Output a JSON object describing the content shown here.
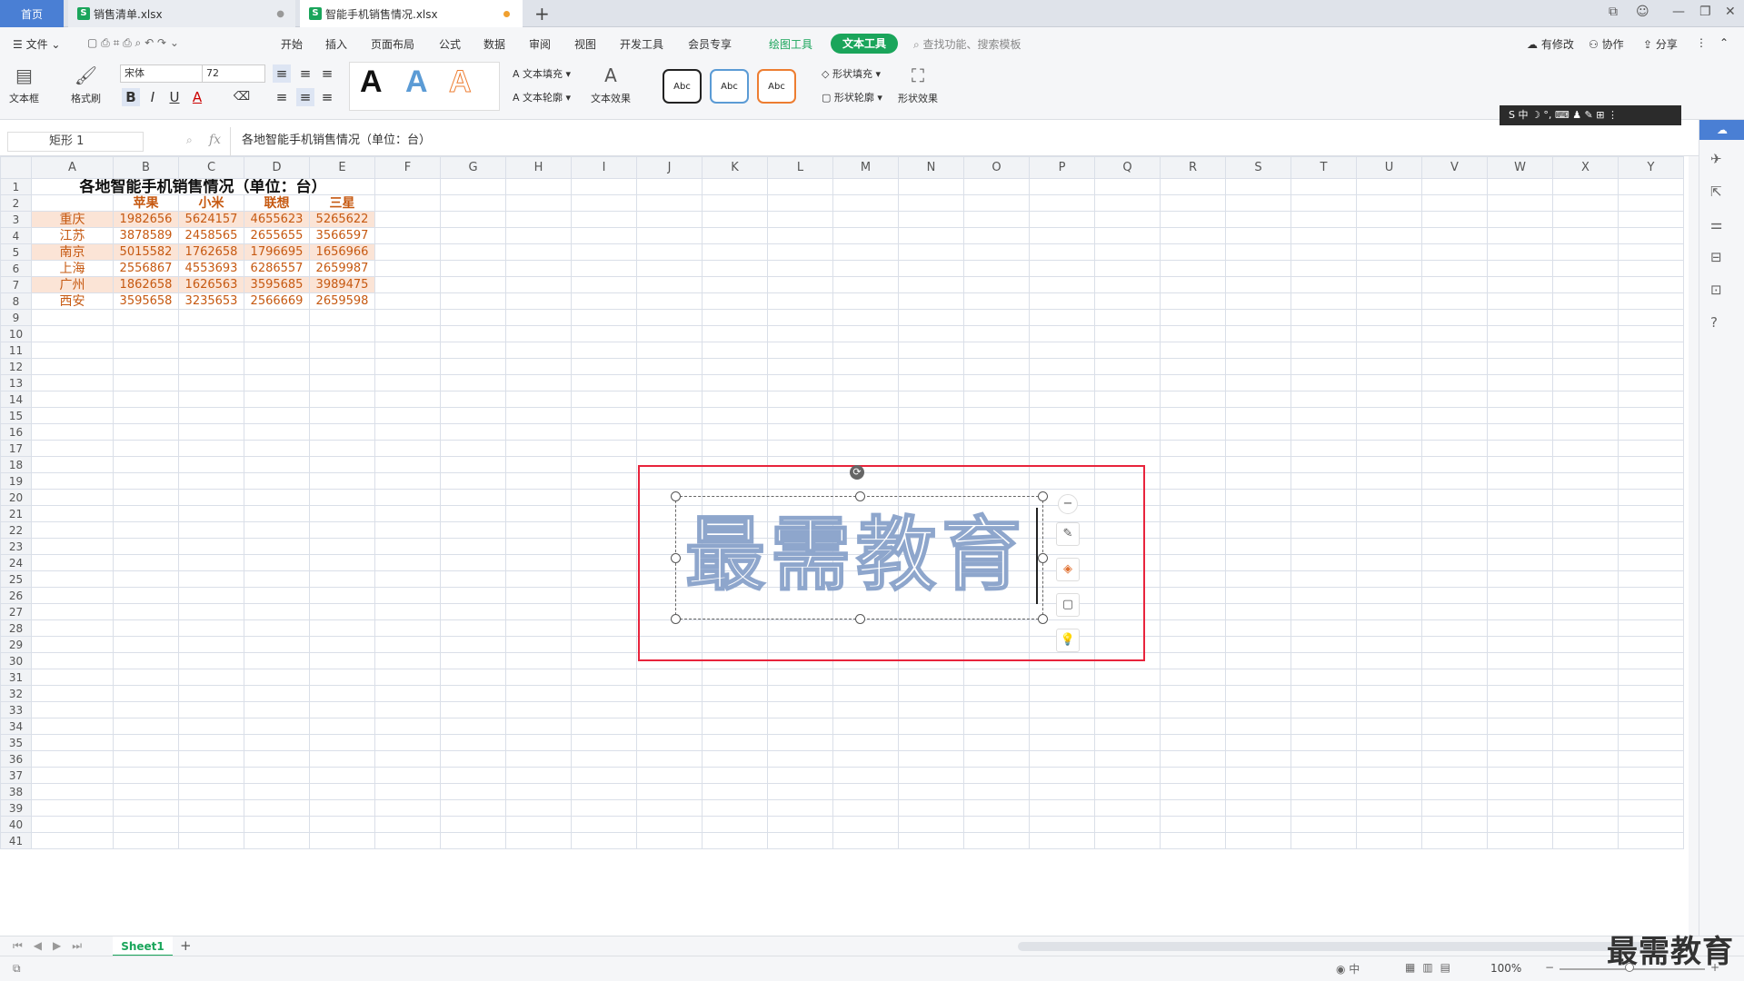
{
  "tabs": {
    "home": "首页",
    "file1": "销售清单.xlsx",
    "file2": "智能手机销售情况.xlsx"
  },
  "menu": {
    "file": "文件",
    "start": "开始",
    "insert": "插入",
    "layout": "页面布局",
    "formula": "公式",
    "data": "数据",
    "review": "审阅",
    "view": "视图",
    "dev": "开发工具",
    "member": "会员专享",
    "draw_tools": "绘图工具",
    "text_tools": "文本工具",
    "search": "查找功能、搜索模板",
    "has_changes": "有修改",
    "collab": "协作",
    "share": "分享"
  },
  "ribbon": {
    "textbox": "文本框",
    "format_painter": "格式刷",
    "font": "宋体",
    "size": "72",
    "bold": "B",
    "italic": "I",
    "underline": "U",
    "fontcolor": "A",
    "text_fill": "文本填充",
    "text_outline": "文本轮廓",
    "text_effect": "文本效果",
    "style_sample": "A",
    "abc": "Abc",
    "shape_fill": "形状填充",
    "shape_outline": "形状轮廓",
    "shape_effect": "形状效果"
  },
  "ime": "S 中 ☽ °, ⌨ ♟ ✎ ⊞ ⋮",
  "formula_bar": {
    "name": "矩形 1",
    "fx": "fx",
    "content": "各地智能手机销售情况（单位：台）"
  },
  "columns": [
    "A",
    "B",
    "C",
    "D",
    "E",
    "F",
    "G",
    "H",
    "I",
    "J",
    "K",
    "L",
    "M",
    "N",
    "O",
    "P",
    "Q",
    "R",
    "S",
    "T",
    "U",
    "V",
    "W",
    "X",
    "Y"
  ],
  "table": {
    "title": "各地智能手机销售情况（单位：台）",
    "brands": [
      "苹果",
      "小米",
      "联想",
      "三星"
    ],
    "rows": [
      {
        "city": "重庆",
        "v": [
          "1982656",
          "5624157",
          "4655623",
          "5265622"
        ]
      },
      {
        "city": "江苏",
        "v": [
          "3878589",
          "2458565",
          "2655655",
          "3566597"
        ]
      },
      {
        "city": "南京",
        "v": [
          "5015582",
          "1762658",
          "1796695",
          "1656966"
        ]
      },
      {
        "city": "上海",
        "v": [
          "2556867",
          "4553693",
          "6286557",
          "2659987"
        ]
      },
      {
        "city": "广州",
        "v": [
          "1862658",
          "1626563",
          "3595685",
          "3989475"
        ]
      },
      {
        "city": "西安",
        "v": [
          "3595658",
          "3235653",
          "2566669",
          "2659598"
        ]
      }
    ]
  },
  "wordart": "最需教育",
  "sheet_tab": "Sheet1",
  "zoom": "100%",
  "watermark": "最需教育",
  "colors": {
    "accent": "#1aa55b",
    "brand_text": "#c65911",
    "stripe": "#fbe4d6",
    "highlight": "#e8243c",
    "home_tab": "#4a7fd4"
  }
}
